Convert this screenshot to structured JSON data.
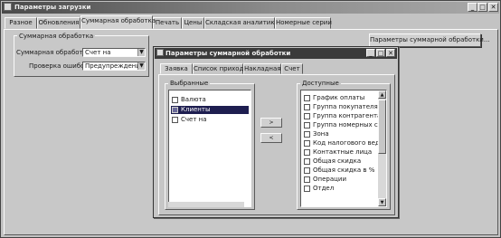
{
  "window": {
    "title": "Параметры загрузки"
  },
  "main_tabs": [
    "Разное",
    "Обновления",
    "Суммарная обработка",
    "Печать",
    "Цены",
    "Складская аналитика",
    "Номерные серии"
  ],
  "active_tab": "Суммарная обработка",
  "group": {
    "title": "Суммарная обработка",
    "field1_label": "Суммарная обработка",
    "field1_value": "Счет на",
    "field2_label": "Проверка ошибок",
    "field2_value": "Предупреждение"
  },
  "params_button": "Параметры суммарной обработки...",
  "dialog": {
    "title": "Параметры суммарной обработки",
    "tabs": [
      "Заявка",
      "Список прихода",
      "Накладная",
      "Счет"
    ],
    "selected": {
      "title": "Выбранные",
      "items": [
        "Валюта",
        "Клиенты",
        "Счет на"
      ],
      "highlighted_index": 1
    },
    "available": {
      "title": "Доступные",
      "items": [
        "График оплаты",
        "Группа покупателя",
        "Группа контрагента",
        "Группа номерных сер",
        "Зона",
        "Код налогового ведомства",
        "Контактные лица",
        "Общая скидка",
        "Общая скидка в %",
        "Операции",
        "Отдел"
      ]
    },
    "move_right": ">",
    "move_left": "<"
  }
}
